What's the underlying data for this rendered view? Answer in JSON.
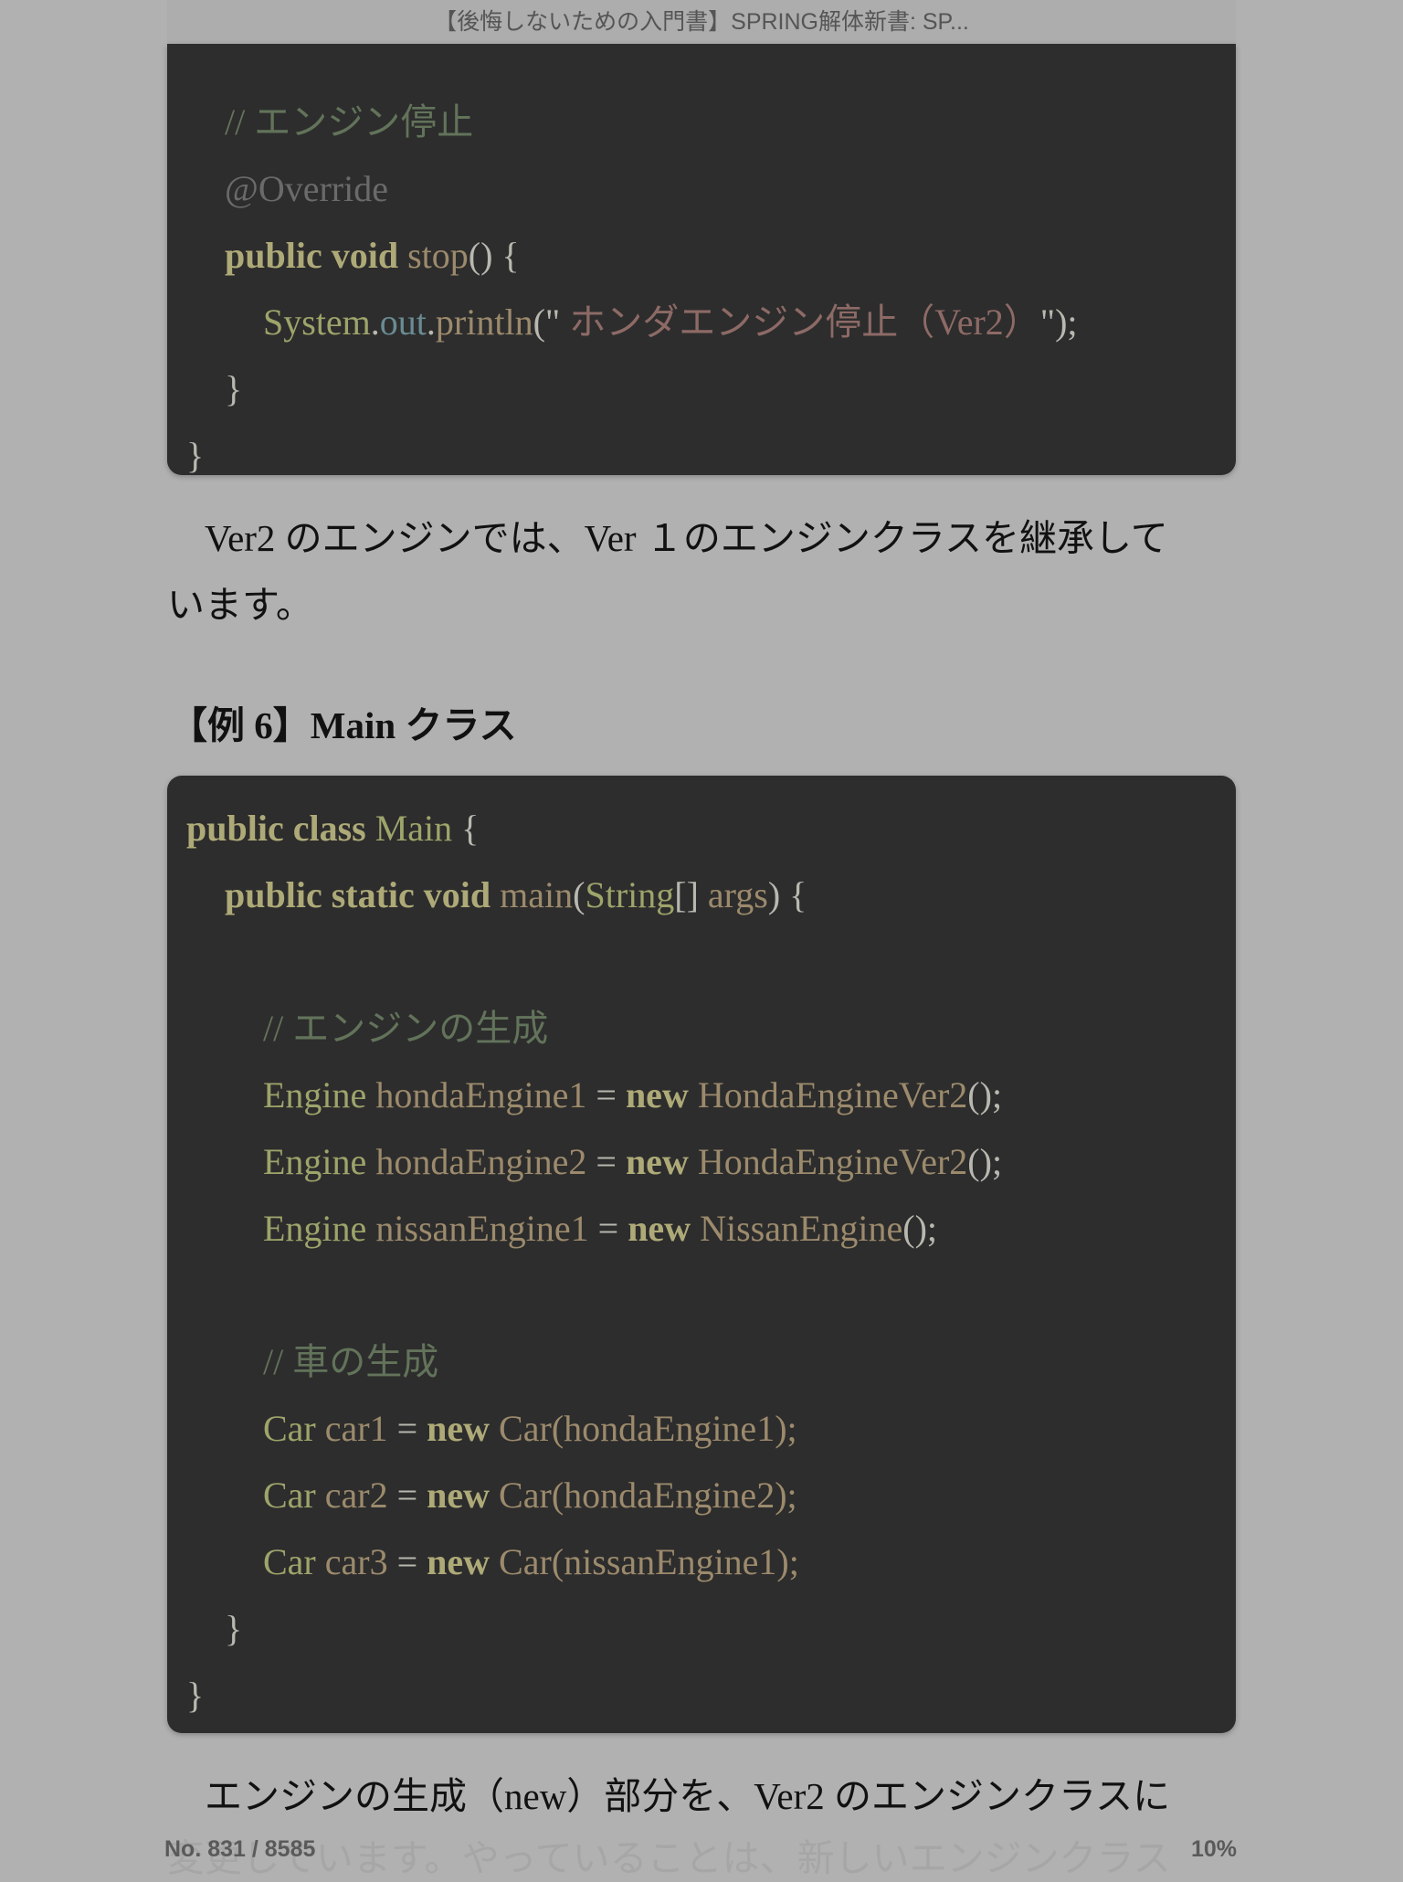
{
  "header": {
    "title": "【後悔しないための入門書】SPRING解体新書: SP..."
  },
  "colors": {
    "background": "#b1b1b1",
    "code_background": "#2d2d2d",
    "keyword": "#aeaa78",
    "type": "#9ea46a",
    "method": "#9c8a6c",
    "comment": "#62735a",
    "annotation": "#6a6a6a",
    "string": "#8d6a66",
    "field": "#6a8b92",
    "plain": "#b8b8b0"
  },
  "code_block_1": {
    "lines": [
      {
        "indent": 1,
        "tokens": [
          {
            "t": "// エンジン停止",
            "c": "comment"
          }
        ]
      },
      {
        "indent": 1,
        "tokens": [
          {
            "t": "@Override",
            "c": "annotation"
          }
        ]
      },
      {
        "indent": 1,
        "tokens": [
          {
            "t": "public void ",
            "c": "keyword",
            "b": true
          },
          {
            "t": "stop",
            "c": "method"
          },
          {
            "t": "() {",
            "c": "plain"
          }
        ]
      },
      {
        "indent": 2,
        "tokens": [
          {
            "t": "System",
            "c": "type"
          },
          {
            "t": ".",
            "c": "plain"
          },
          {
            "t": "out",
            "c": "field"
          },
          {
            "t": ".",
            "c": "plain"
          },
          {
            "t": "println",
            "c": "method"
          },
          {
            "t": "(\"",
            "c": "plain"
          },
          {
            "t": " ホンダエンジン停止（Ver2）",
            "c": "string"
          },
          {
            "t": "\");",
            "c": "plain"
          }
        ]
      },
      {
        "indent": 1,
        "tokens": [
          {
            "t": "}",
            "c": "plain"
          }
        ]
      },
      {
        "indent": 0,
        "tokens": [
          {
            "t": "}",
            "c": "plain"
          }
        ]
      }
    ]
  },
  "paragraph_1": {
    "line1": "　Ver2 のエンジンでは、Ver １のエンジンクラスを継承して",
    "line2": "います。"
  },
  "heading": "【例 6】Main クラス",
  "code_block_2": {
    "lines": [
      {
        "indent": 0,
        "tokens": [
          {
            "t": "public class ",
            "c": "keyword",
            "b": true
          },
          {
            "t": "Main",
            "c": "type"
          },
          {
            "t": " {",
            "c": "plain"
          }
        ]
      },
      {
        "indent": 1,
        "tokens": [
          {
            "t": "public static void ",
            "c": "keyword",
            "b": true
          },
          {
            "t": "main",
            "c": "method"
          },
          {
            "t": "(",
            "c": "plain"
          },
          {
            "t": "String",
            "c": "type"
          },
          {
            "t": "[] ",
            "c": "plain"
          },
          {
            "t": "args",
            "c": "method"
          },
          {
            "t": ") {",
            "c": "plain"
          }
        ]
      },
      {
        "indent": 2,
        "tokens": []
      },
      {
        "indent": 2,
        "tokens": [
          {
            "t": "// エンジンの生成",
            "c": "comment"
          }
        ]
      },
      {
        "indent": 2,
        "tokens": [
          {
            "t": "Engine ",
            "c": "type"
          },
          {
            "t": "hondaEngine1",
            "c": "method"
          },
          {
            "t": " = ",
            "c": "plain"
          },
          {
            "t": "new ",
            "c": "keyword",
            "b": true
          },
          {
            "t": "HondaEngineVer2",
            "c": "method"
          },
          {
            "t": "();",
            "c": "plain"
          }
        ]
      },
      {
        "indent": 2,
        "tokens": [
          {
            "t": "Engine ",
            "c": "type"
          },
          {
            "t": "hondaEngine2",
            "c": "method"
          },
          {
            "t": " = ",
            "c": "plain"
          },
          {
            "t": "new ",
            "c": "keyword",
            "b": true
          },
          {
            "t": "HondaEngineVer2",
            "c": "method"
          },
          {
            "t": "();",
            "c": "plain"
          }
        ]
      },
      {
        "indent": 2,
        "tokens": [
          {
            "t": "Engine ",
            "c": "type"
          },
          {
            "t": "nissanEngine1",
            "c": "method"
          },
          {
            "t": " = ",
            "c": "plain"
          },
          {
            "t": "new ",
            "c": "keyword",
            "b": true
          },
          {
            "t": "NissanEngine",
            "c": "method"
          },
          {
            "t": "();",
            "c": "plain"
          }
        ]
      },
      {
        "indent": 2,
        "tokens": []
      },
      {
        "indent": 2,
        "tokens": [
          {
            "t": "// 車の生成",
            "c": "comment"
          }
        ]
      },
      {
        "indent": 2,
        "tokens": [
          {
            "t": "Car ",
            "c": "type"
          },
          {
            "t": "car1",
            "c": "method"
          },
          {
            "t": " = ",
            "c": "plain"
          },
          {
            "t": "new ",
            "c": "keyword",
            "b": true
          },
          {
            "t": "Car",
            "c": "method"
          },
          {
            "t": "(hondaEngine1);",
            "c": "method"
          }
        ]
      },
      {
        "indent": 2,
        "tokens": [
          {
            "t": "Car ",
            "c": "type"
          },
          {
            "t": "car2",
            "c": "method"
          },
          {
            "t": " = ",
            "c": "plain"
          },
          {
            "t": "new ",
            "c": "keyword",
            "b": true
          },
          {
            "t": "Car",
            "c": "method"
          },
          {
            "t": "(hondaEngine2);",
            "c": "method"
          }
        ]
      },
      {
        "indent": 2,
        "tokens": [
          {
            "t": "Car ",
            "c": "type"
          },
          {
            "t": "car3",
            "c": "method"
          },
          {
            "t": " = ",
            "c": "plain"
          },
          {
            "t": "new ",
            "c": "keyword",
            "b": true
          },
          {
            "t": "Car",
            "c": "method"
          },
          {
            "t": "(nissanEngine1);",
            "c": "method"
          }
        ]
      },
      {
        "indent": 1,
        "tokens": [
          {
            "t": "}",
            "c": "plain"
          }
        ]
      },
      {
        "indent": 0,
        "tokens": [
          {
            "t": "}",
            "c": "plain"
          }
        ]
      }
    ]
  },
  "paragraph_2": {
    "line1": "　エンジンの生成（new）部分を、Ver2 のエンジンクラスに",
    "line2_faded": "変更しています。やっていることは、新しいエンジンクラス"
  },
  "footer": {
    "location": "No. 831 / 8585",
    "progress": "10%",
    "progress_percent": 10
  }
}
